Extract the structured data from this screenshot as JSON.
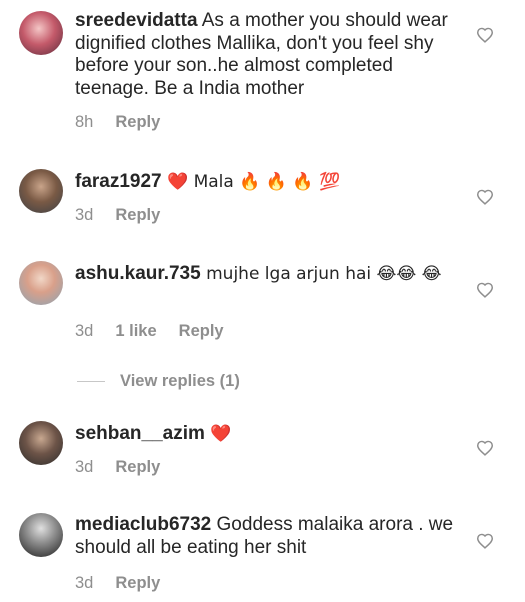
{
  "comments": [
    {
      "username": "sreedevidatta",
      "text": " As a mother you should wear dignified clothes Mallika, don't you feel shy before your son..he almost completed teenage. Be a India mother",
      "time": "8h",
      "likes": "",
      "reply": "Reply"
    },
    {
      "username": "faraz1927",
      "text": " ❤️ Mala 🔥 🔥 🔥 💯",
      "time": "3d",
      "likes": "",
      "reply": "Reply"
    },
    {
      "username": "ashu.kaur.735",
      "text": " mujhe lga arjun hai 😂😂 😂",
      "time": "3d",
      "likes": "1 like",
      "reply": "Reply"
    },
    {
      "username": "sehban__azim",
      "text": " ❤️",
      "time": "3d",
      "likes": "",
      "reply": "Reply"
    },
    {
      "username": "mediaclub6732",
      "text": " Goddess malaika arora . we should all be eating her shit",
      "time": "3d",
      "likes": "",
      "reply": "Reply"
    }
  ],
  "view_replies": "View replies (1)",
  "colors": {
    "text": "#262626",
    "meta": "#8e8e8e",
    "heart_outline": "#8e8e8e"
  },
  "icons": {
    "like": "heart-outline-icon"
  }
}
